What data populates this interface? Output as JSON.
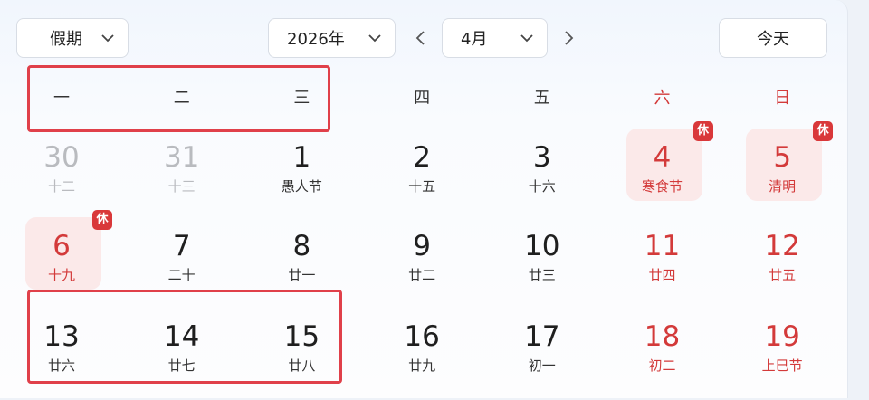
{
  "toolbar": {
    "holiday_label": "假期",
    "year_label": "2026年",
    "month_label": "4月",
    "today_label": "今天"
  },
  "weekdays": [
    "一",
    "二",
    "三",
    "四",
    "五",
    "六",
    "日"
  ],
  "rows": [
    [
      {
        "day": "30",
        "sub": "十二",
        "style": "other"
      },
      {
        "day": "31",
        "sub": "十三",
        "style": "other"
      },
      {
        "day": "1",
        "sub": "愚人节",
        "style": "normal"
      },
      {
        "day": "2",
        "sub": "十五",
        "style": "normal"
      },
      {
        "day": "3",
        "sub": "十六",
        "style": "normal"
      },
      {
        "day": "4",
        "sub": "寒食节",
        "style": "red",
        "rest": "休"
      },
      {
        "day": "5",
        "sub": "清明",
        "style": "red",
        "rest": "休"
      }
    ],
    [
      {
        "day": "6",
        "sub": "十九",
        "style": "red",
        "rest": "休"
      },
      {
        "day": "7",
        "sub": "二十",
        "style": "normal"
      },
      {
        "day": "8",
        "sub": "廿一",
        "style": "normal"
      },
      {
        "day": "9",
        "sub": "廿二",
        "style": "normal"
      },
      {
        "day": "10",
        "sub": "廿三",
        "style": "normal"
      },
      {
        "day": "11",
        "sub": "廿四",
        "style": "red"
      },
      {
        "day": "12",
        "sub": "廿五",
        "style": "red"
      }
    ],
    [
      {
        "day": "13",
        "sub": "廿六",
        "style": "normal"
      },
      {
        "day": "14",
        "sub": "廿七",
        "style": "normal"
      },
      {
        "day": "15",
        "sub": "廿八",
        "style": "normal"
      },
      {
        "day": "16",
        "sub": "廿九",
        "style": "normal"
      },
      {
        "day": "17",
        "sub": "初一",
        "style": "normal"
      },
      {
        "day": "18",
        "sub": "初二",
        "style": "red"
      },
      {
        "day": "19",
        "sub": "上巳节",
        "style": "red"
      }
    ]
  ],
  "colors": {
    "holiday_red": "#d33a3a",
    "highlight_box": "#e0404a",
    "rest_bg": "#fbe9e9"
  }
}
